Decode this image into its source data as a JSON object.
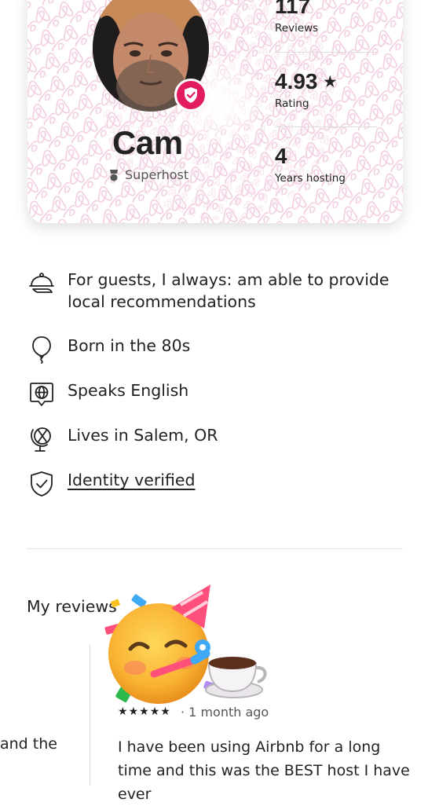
{
  "host": {
    "name": "Cam",
    "badge": "Superhost"
  },
  "stats": [
    {
      "value": "117",
      "label": "Reviews"
    },
    {
      "value": "4.93",
      "label": "Rating"
    },
    {
      "value": "4",
      "label": "Years hosting"
    }
  ],
  "facts": [
    {
      "icon": "service-bell-icon",
      "text": "For guests, I always: am able to provide local recommendations"
    },
    {
      "icon": "balloon-icon",
      "text": "Born in the 80s"
    },
    {
      "icon": "speech-globe-icon",
      "text": "Speaks English"
    },
    {
      "icon": "globe-stand-icon",
      "text": "Lives in Salem, OR"
    },
    {
      "icon": "shield-check-icon",
      "text": "Identity verified"
    }
  ],
  "reviews": {
    "title": "My reviews",
    "previous_snippet": "and the",
    "card": {
      "rating": 5,
      "time_ago": "1 month ago",
      "text": "I have been using Airbnb for a long time and this was the BEST host I have ever"
    }
  },
  "colors": {
    "brand": "#e31c5f",
    "pattern": "#f1cde0",
    "text": "#222222",
    "muted": "#555555",
    "divider": "#e4e4e4"
  }
}
